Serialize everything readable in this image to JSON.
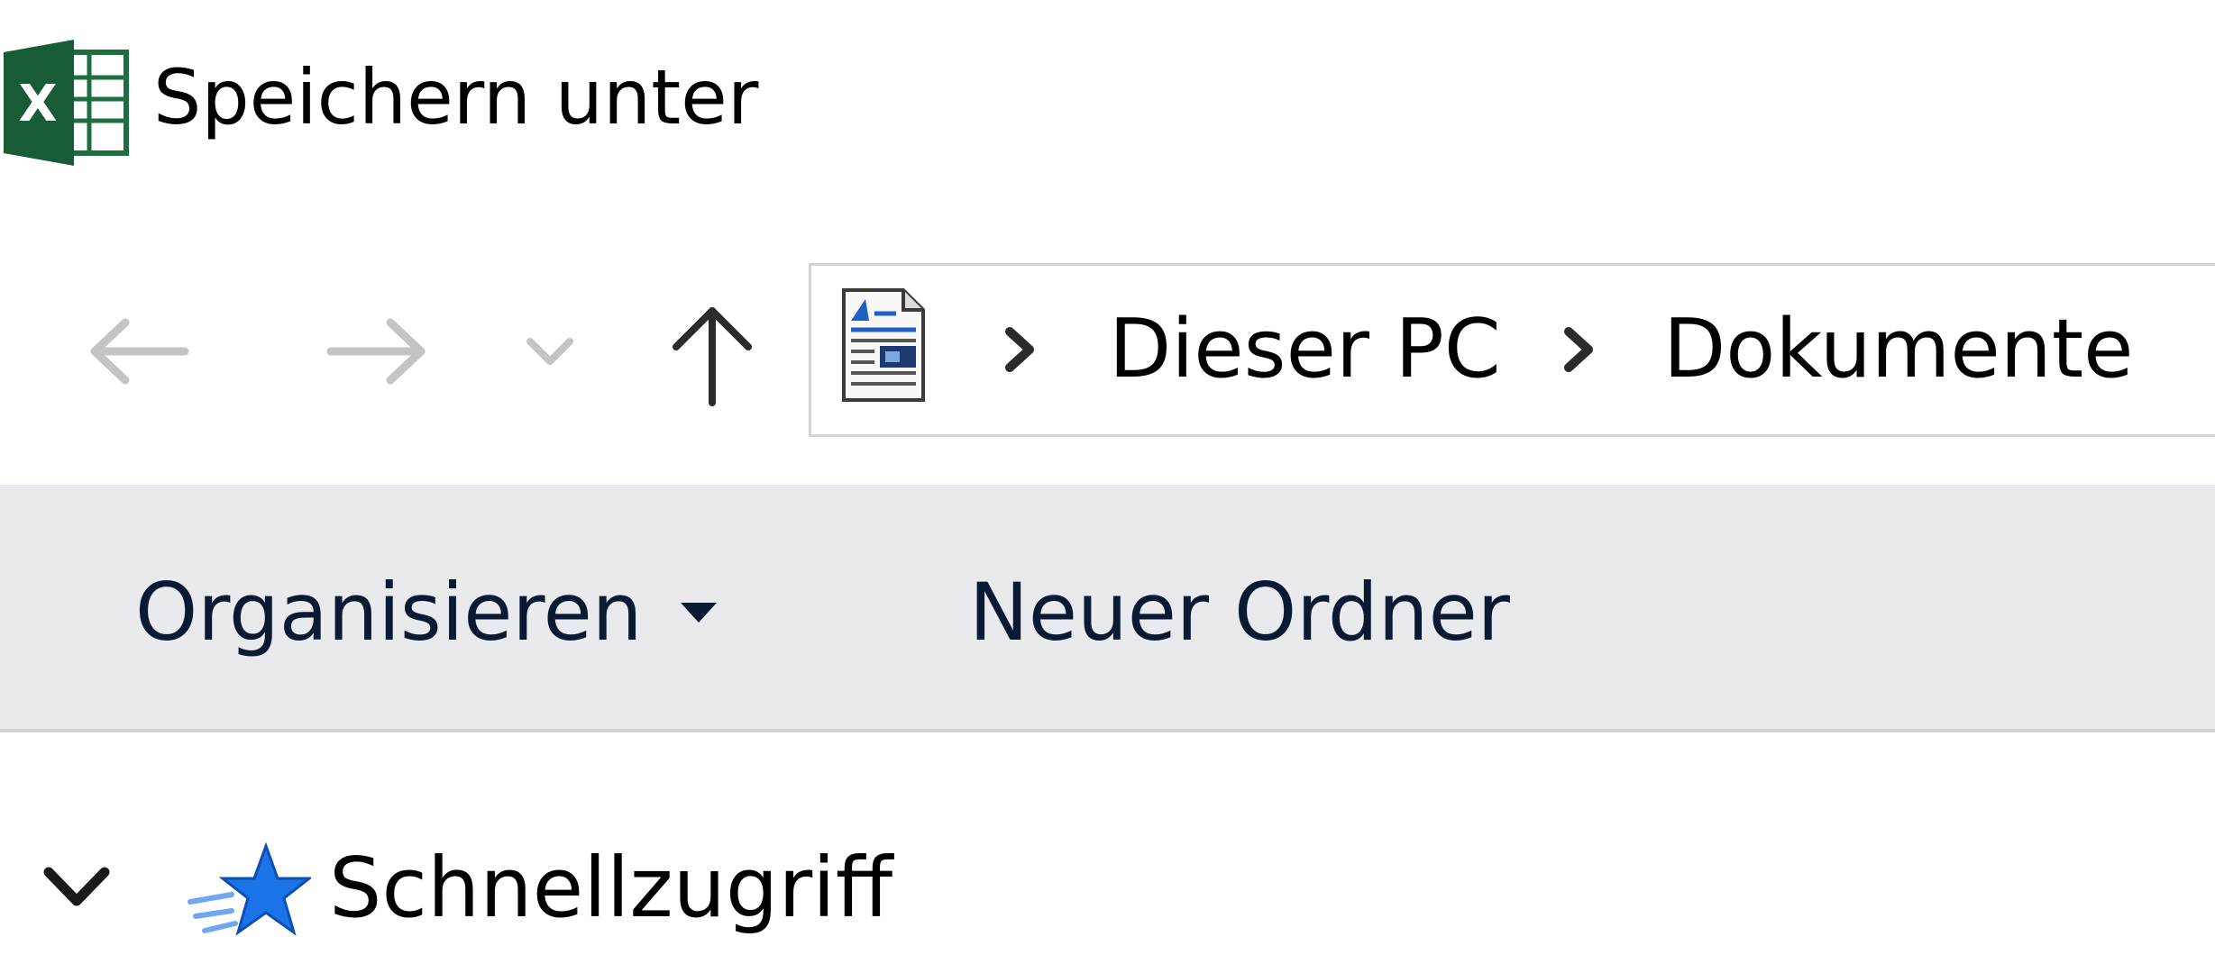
{
  "window": {
    "title": "Speichern unter",
    "app_icon": "excel-icon",
    "app_icon_letter": "X"
  },
  "navigation": {
    "back_icon": "back-arrow-icon",
    "forward_icon": "forward-arrow-icon",
    "recent_icon": "chevron-down-icon",
    "up_icon": "up-arrow-icon",
    "disabled_color": "#c4c4c4",
    "enabled_color": "#2b2b2b"
  },
  "address_bar": {
    "location_icon": "documents-folder-icon",
    "breadcrumb": [
      "Dieser PC",
      "Dokumente"
    ]
  },
  "command_bar": {
    "organize_label": "Organisieren",
    "new_folder_label": "Neuer Ordner",
    "background": "#e9eaed"
  },
  "tree": {
    "quick_access_label": "Schnellzugriff",
    "quick_access_icon": "star-icon",
    "accent": "#1a73e8"
  },
  "colors": {
    "excel_green": "#1d6f42",
    "text_dark": "#0b1a33"
  }
}
